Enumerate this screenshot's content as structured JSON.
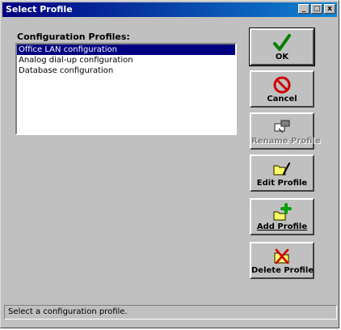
{
  "window": {
    "title": "Select Profile",
    "minimize_glyph": "_",
    "maximize_glyph": "□",
    "close_glyph": "x"
  },
  "profiles": {
    "label": "Configuration Profiles:",
    "items": [
      {
        "label": "Office LAN configuration",
        "selected": true
      },
      {
        "label": "Analog dial-up configuration",
        "selected": false
      },
      {
        "label": "Database configuration",
        "selected": false
      }
    ]
  },
  "buttons": {
    "ok": "OK",
    "cancel": "Cancel",
    "rename": "Rename Profile",
    "edit": "Edit Profile",
    "add": "Add Profile",
    "delete": "Delete Profile"
  },
  "status": "Select a configuration profile.",
  "icons": {
    "ok": "checkmark-icon",
    "cancel": "prohibited-icon",
    "rename": "rename-folder-icon",
    "edit": "edit-folder-icon",
    "add": "add-folder-icon",
    "delete": "delete-folder-icon"
  },
  "colors": {
    "titlebar": "#000080",
    "selection": "#000080",
    "face": "#c0c0c0"
  }
}
